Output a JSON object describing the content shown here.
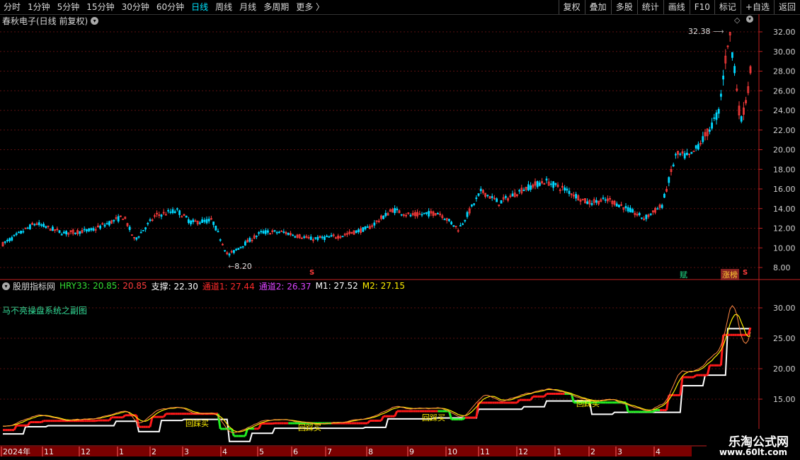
{
  "toolbar": {
    "periods": [
      "分时",
      "1分钟",
      "5分钟",
      "15分钟",
      "30分钟",
      "60分钟",
      "日线",
      "周线",
      "月线",
      "多周期",
      "更多 〉"
    ],
    "active_period": "日线",
    "buttons": [
      "复权",
      "叠加",
      "多股",
      "统计",
      "画线",
      "F10",
      "标记",
      "+自选",
      "返回"
    ]
  },
  "main_panel": {
    "title": "春秋电子(日线 前复权)",
    "high_label": "32.38",
    "low_label": "8.20",
    "y_ticks": [
      "32.00",
      "30.00",
      "28.00",
      "26.00",
      "24.00",
      "22.00",
      "20.00",
      "18.00",
      "16.00",
      "14.00",
      "12.00",
      "10.00",
      "8.00"
    ],
    "markers": [
      "S",
      "S"
    ],
    "badges": [
      "赋",
      "涨榜"
    ]
  },
  "sub_panel": {
    "name": "股朋指标网",
    "hry33": "HRY33: 20.85",
    "hry33_b": ": 20.85",
    "support": "支撑: 22.30",
    "ch1": "通道1: 27.44",
    "ch2": "通道2: 26.37",
    "m1": "M1: 27.52",
    "m2": "M2: 27.15",
    "subtitle": "马不亮操盘系统之副图",
    "y_ticks": [
      "30.00",
      "25.00",
      "20.00",
      "15.00"
    ],
    "signals": [
      "回踩买",
      "回踩买",
      "回踩买",
      "回踩买",
      "回踩买"
    ]
  },
  "x_axis": {
    "labels": [
      "2024年",
      "11",
      "12",
      "1",
      "2",
      "3",
      "4",
      "5",
      "6",
      "7",
      "8",
      "9",
      "10",
      "11",
      "12",
      "1",
      "2",
      "3",
      "4"
    ]
  },
  "watermark": {
    "title": "乐淘公式网",
    "url": "www.60lt.com"
  },
  "colors": {
    "up": "#ff3c3c",
    "down": "#00d8ff",
    "active": "#00e5ff",
    "hry": "#33dd33",
    "ch1": "#ff2a2a",
    "ch2": "#dd44ff",
    "m1": "#ffffff",
    "m2": "#ffee00"
  }
}
